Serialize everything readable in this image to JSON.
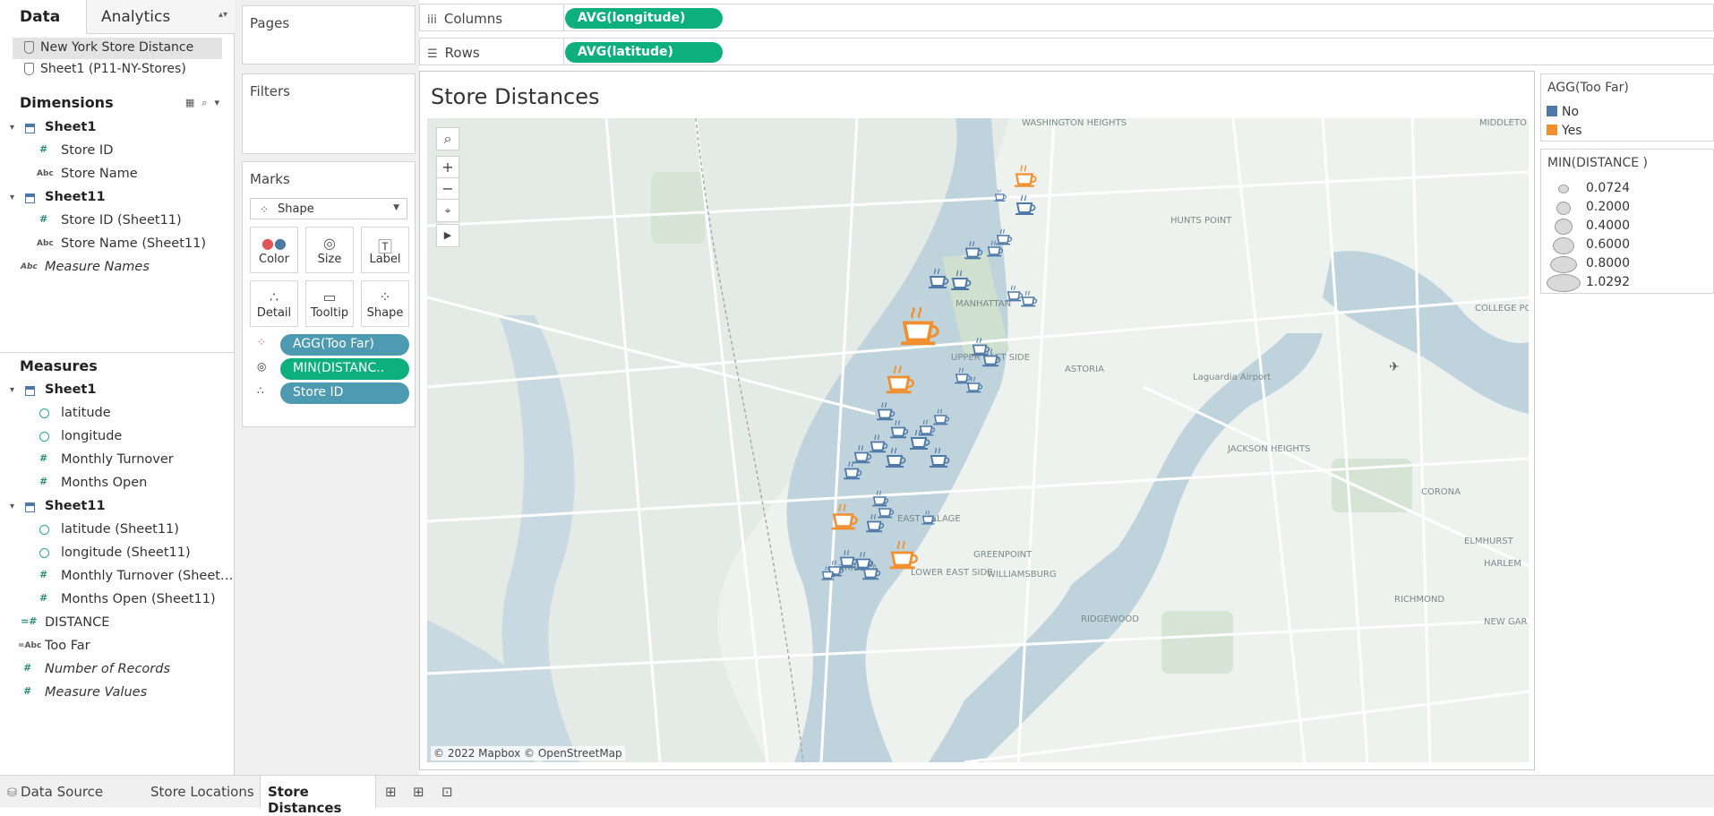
{
  "data_pane": {
    "tabs": [
      "Data",
      "Analytics"
    ],
    "sources": [
      "New York Store Distance",
      "Sheet1 (P11-NY-Stores)"
    ],
    "dimensions_title": "Dimensions",
    "dimensions": [
      {
        "label": "Sheet1",
        "kind": "table"
      },
      {
        "label": "Store ID",
        "kind": "number"
      },
      {
        "label": "Store Name",
        "kind": "string"
      },
      {
        "label": "Sheet11",
        "kind": "table"
      },
      {
        "label": "Store ID (Sheet11)",
        "kind": "number"
      },
      {
        "label": "Store Name (Sheet11)",
        "kind": "string"
      },
      {
        "label": "Measure Names",
        "kind": "string-italic"
      }
    ],
    "measures_title": "Measures",
    "measures": [
      {
        "label": "Sheet1",
        "kind": "table"
      },
      {
        "label": "latitude",
        "kind": "geo"
      },
      {
        "label": "longitude",
        "kind": "geo"
      },
      {
        "label": "Monthly Turnover",
        "kind": "number"
      },
      {
        "label": "Months Open",
        "kind": "number"
      },
      {
        "label": "Sheet11",
        "kind": "table"
      },
      {
        "label": "latitude (Sheet11)",
        "kind": "geo"
      },
      {
        "label": "longitude (Sheet11)",
        "kind": "geo"
      },
      {
        "label": "Monthly Turnover (Sheet…",
        "kind": "number"
      },
      {
        "label": "Months Open (Sheet11)",
        "kind": "number"
      },
      {
        "label": "DISTANCE",
        "kind": "calc-number"
      },
      {
        "label": "Too Far",
        "kind": "calc-string"
      },
      {
        "label": "Number of Records",
        "kind": "number-italic"
      },
      {
        "label": "Measure Values",
        "kind": "number-italic"
      }
    ]
  },
  "cards": {
    "pages": "Pages",
    "filters": "Filters",
    "marks": "Marks",
    "mark_type": "Shape",
    "buttons": [
      "Color",
      "Size",
      "Label",
      "Detail",
      "Tooltip",
      "Shape"
    ],
    "pills": [
      {
        "label": "AGG(Too Far)",
        "color": "#4e9ab0"
      },
      {
        "label": "MIN(DISTANC..",
        "color": "#0db07d"
      },
      {
        "label": "Store ID",
        "color": "#4e9ab0"
      }
    ]
  },
  "shelves": {
    "columns_label": "Columns",
    "columns_pill": "AVG(longitude)",
    "rows_label": "Rows",
    "rows_pill": "AVG(latitude)"
  },
  "view": {
    "title": "Store Distances",
    "attribution": "© 2022 Mapbox © OpenStreetMap",
    "map_labels": [
      "WASHINGTON HEIGHTS",
      "HUNTS POINT",
      "MIDDLETO",
      "MANHATTAN",
      "COLLEGE POINT",
      "UPPER EAST SIDE",
      "ASTORIA",
      "Laguardia Airport",
      "JACKSON HEIGHTS",
      "CORONA",
      "ELMHURST",
      "EAST VILLAGE",
      "GREENPOINT",
      "TRIBECA",
      "LOWER EAST SIDE",
      "WILLIAMSBURG",
      "RIDGEWOOD",
      "RICHMOND",
      "NEW GAR",
      "HARLEM"
    ]
  },
  "legend_color": {
    "title": "AGG(Too Far)",
    "items": [
      {
        "label": "No",
        "color": "#4e79a7"
      },
      {
        "label": "Yes",
        "color": "#f28e2b"
      }
    ]
  },
  "legend_size": {
    "title": "MIN(DISTANCE )",
    "items": [
      "0.0724",
      "0.2000",
      "0.4000",
      "0.6000",
      "0.8000",
      "1.0292"
    ]
  },
  "bottom_tabs": [
    "Data Source",
    "Store Locations",
    "Store Distances"
  ],
  "chart_data": {
    "type": "scatter",
    "title": "Store Distances",
    "series": [
      {
        "name": "No",
        "color": "#4e79a7",
        "count": 36
      },
      {
        "name": "Yes",
        "color": "#f28e2b",
        "count": 5
      }
    ]
  }
}
